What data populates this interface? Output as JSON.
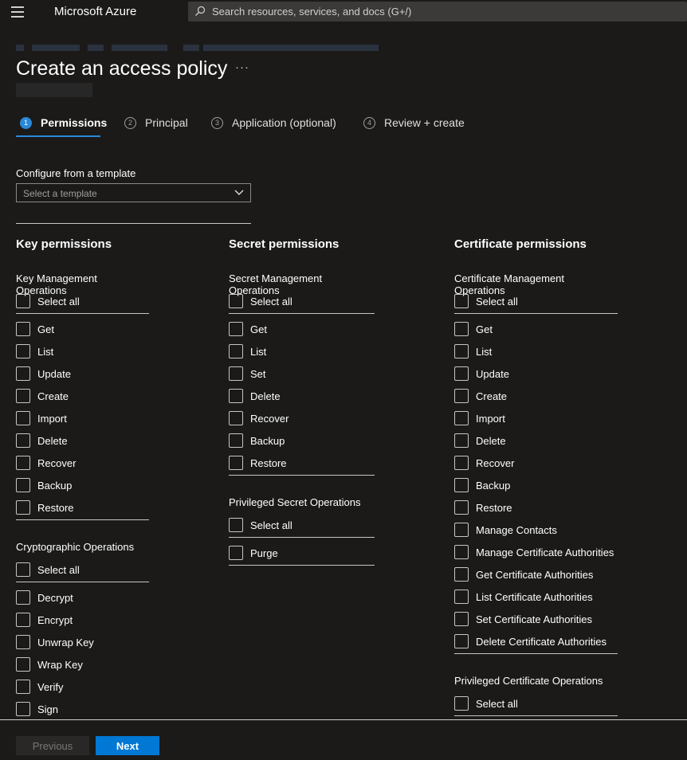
{
  "topbar": {
    "brand": "Microsoft Azure",
    "search_placeholder": "Search resources, services, and docs (G+/)"
  },
  "page": {
    "title": "Create an access policy",
    "more": "···"
  },
  "steps": [
    {
      "num": "1",
      "label": "Permissions",
      "active": true
    },
    {
      "num": "2",
      "label": "Principal"
    },
    {
      "num": "3",
      "label": "Application (optional)"
    },
    {
      "num": "4",
      "label": "Review + create"
    }
  ],
  "template": {
    "label": "Configure from a template",
    "placeholder": "Select a template"
  },
  "key": {
    "heading": "Key permissions",
    "mgmt_title": "Key Management Operations",
    "select_all": "Select all",
    "mgmt": [
      "Get",
      "List",
      "Update",
      "Create",
      "Import",
      "Delete",
      "Recover",
      "Backup",
      "Restore"
    ],
    "crypto_title": "Cryptographic Operations",
    "crypto": [
      "Decrypt",
      "Encrypt",
      "Unwrap Key",
      "Wrap Key",
      "Verify",
      "Sign"
    ]
  },
  "secret": {
    "heading": "Secret permissions",
    "mgmt_title": "Secret Management Operations",
    "select_all": "Select all",
    "mgmt": [
      "Get",
      "List",
      "Set",
      "Delete",
      "Recover",
      "Backup",
      "Restore"
    ],
    "priv_title": "Privileged Secret Operations",
    "priv": [
      "Purge"
    ]
  },
  "cert": {
    "heading": "Certificate permissions",
    "mgmt_title": "Certificate Management Operations",
    "select_all": "Select all",
    "mgmt": [
      "Get",
      "List",
      "Update",
      "Create",
      "Import",
      "Delete",
      "Recover",
      "Backup",
      "Restore",
      "Manage Contacts",
      "Manage Certificate Authorities",
      "Get Certificate Authorities",
      "List Certificate Authorities",
      "Set Certificate Authorities",
      "Delete Certificate Authorities"
    ],
    "priv_title": "Privileged Certificate Operations"
  },
  "footer": {
    "previous": "Previous",
    "next": "Next"
  },
  "colors": {
    "background": "#1b1a19",
    "accent": "#0078d4",
    "step_active": "#2b88d8"
  }
}
